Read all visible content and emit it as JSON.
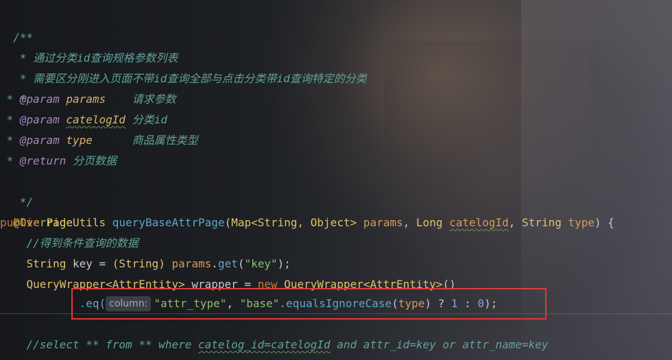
{
  "editor": {
    "doc_open": "/**",
    "doc_line1": " * 通过分类id查询规格参数列表",
    "doc_line2": " * 需要区分刚进入页面不带id查询全部与点击分类带id查询特定的分类",
    "doc_line3": " *",
    "doc_star": " * ",
    "param_tag": "@param",
    "param1_name": "params",
    "param1_desc": "请求参数",
    "param2_name": "catelogId",
    "param2_desc": "分类id",
    "param3_name": "type",
    "param3_desc": "商品属性类型",
    "return_tag": "@return",
    "return_desc": "分页数据",
    "doc_close": " */",
    "annotation": "@Override",
    "sig_public": "public",
    "sig_return_type": "PageUtils",
    "sig_method": "queryBaseAttrPage",
    "sig_p1_type": "Map<String, Object>",
    "sig_p1_name": "params",
    "sig_p2_type": "Long",
    "sig_p2_name": "catelogId",
    "sig_p3_type": "String",
    "sig_p3_name": "type",
    "comment_get_data": "//得到条件查询的数据",
    "key_type": "String",
    "key_name": "key",
    "key_cast": "(String)",
    "key_params": "params",
    "key_get": "get",
    "key_literal": "\"key\"",
    "wrapper_type": "QueryWrapper<AttrEntity>",
    "wrapper_name": "wrapper",
    "new_kw": "new",
    "wrapper_ctor": "QueryWrapper<AttrEntity>",
    "eq_method": ".eq(",
    "hint_label": "column:",
    "eq_arg1": "\"attr_type\"",
    "eq_arg2": "\"base\"",
    "eq_call": ".equalsIgnoreCase",
    "eq_type": "type",
    "eq_one": "1",
    "eq_zero": "0",
    "select_comment_a": "//select ** from ** where ",
    "select_comment_b": "catelog_id=catelogId",
    "select_comment_c": " and attr_id=key or attr_name=key"
  }
}
